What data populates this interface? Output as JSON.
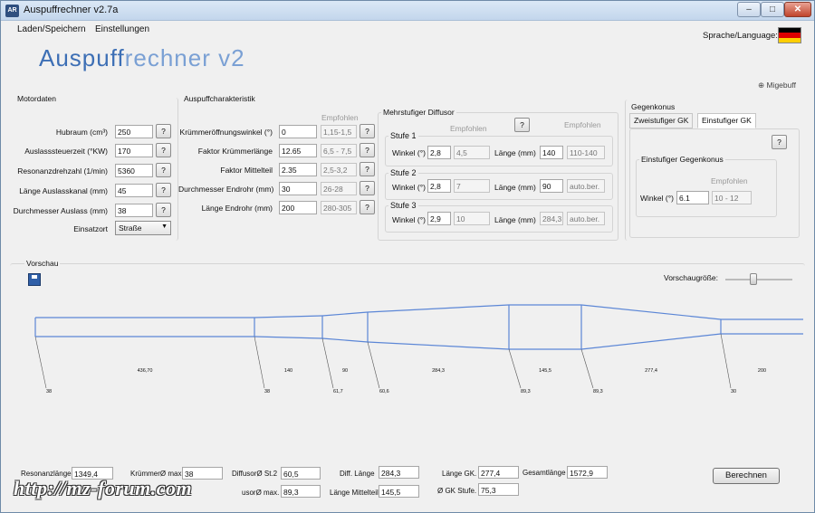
{
  "window": {
    "title": "Auspuffrechner v2.7a",
    "icon": "AR"
  },
  "menu": {
    "items": [
      "Laden/Speichern",
      "Einstellungen"
    ],
    "language_label": "Sprache/Language:",
    "flag_colors": [
      "#000000",
      "#dd0000",
      "#ffce00"
    ]
  },
  "logo": {
    "part1": "Auspuff",
    "part2": "rechner  v2"
  },
  "migebuff": "⊕ Migebuff",
  "motordaten": {
    "title": "Motordaten",
    "rows": [
      {
        "label": "Hubraum (cm³)",
        "value": "250"
      },
      {
        "label": "Auslasssteuerzeit (°KW)",
        "value": "170"
      },
      {
        "label": "Resonanzdrehzahl (1/min)",
        "value": "5360"
      },
      {
        "label": "Länge Auslasskanal (mm)",
        "value": "45"
      },
      {
        "label": "Durchmesser Auslass (mm)",
        "value": "38"
      }
    ],
    "einsatzort_label": "Einsatzort",
    "einsatzort_value": "Straße",
    "help": "?"
  },
  "auspuff": {
    "title": "Auspuffcharakteristik",
    "empfohlen": "Empfohlen",
    "rows": [
      {
        "label": "Krümmeröffnungswinkel (°)",
        "value": "0",
        "rec": "1,15-1,5"
      },
      {
        "label": "Faktor Krümmerlänge",
        "value": "12.65",
        "rec": "6,5 - 7,5"
      },
      {
        "label": "Faktor Mittelteil",
        "value": "2.35",
        "rec": "2,5-3,2"
      },
      {
        "label": "Durchmesser Endrohr (mm)",
        "value": "30",
        "rec": "26-28"
      },
      {
        "label": "Länge Endrohr (mm)",
        "value": "200",
        "rec": "280-305"
      }
    ]
  },
  "diffusor": {
    "title": "Mehrstufiger Diffusor",
    "empfohlen1": "Empfohlen",
    "empfohlen2": "Empfohlen",
    "winkel_label": "Winkel (°)",
    "laenge_label": "Länge (mm)",
    "stufen": [
      {
        "name": "Stufe 1",
        "winkel": "2,8",
        "winkel_rec": "4,5",
        "laenge": "140",
        "laenge_rec": "110-140"
      },
      {
        "name": "Stufe 2",
        "winkel": "2,8",
        "winkel_rec": "7",
        "laenge": "90",
        "laenge_rec": "auto.ber."
      },
      {
        "name": "Stufe 3",
        "winkel": "2,9",
        "winkel_rec": "10",
        "laenge": "284,3",
        "laenge_rec": "auto.ber."
      }
    ]
  },
  "gegenkonus": {
    "title": "Gegenkonus",
    "tabs": [
      "Zweistufiger GK",
      "Einstufiger GK"
    ],
    "inner_title": "Einstufiger Gegenkonus",
    "empfohlen": "Empfohlen",
    "winkel_label": "Winkel (°)",
    "winkel": "6.1",
    "winkel_rec": "10 - 12"
  },
  "vorschau": {
    "title": "Vorschau",
    "size_label": "Vorschaugröße:",
    "line_color": "#5b86d6",
    "lengths": [
      "436,70",
      "140",
      "90",
      "284,3",
      "145,5",
      "277,4",
      "200"
    ],
    "diameters": [
      "38",
      "38",
      "61,7",
      "60,6",
      "89,3",
      "89,3",
      "30"
    ]
  },
  "results": {
    "resonanzlaenge_label": "Resonanzlänge",
    "resonanzlaenge": "1349,4",
    "kruemmer_max_label": "KrümmerØ max",
    "kruemmer_max": "38",
    "diffusor_st2_label": "DiffusorØ St.2",
    "diffusor_st2": "60,5",
    "diff_laenge_label": "Diff. Länge",
    "diff_laenge": "284,3",
    "laenge_gk_label": "Länge GK.",
    "laenge_gk": "277,4",
    "gesamtlaenge_label": "Gesamtlänge",
    "gesamtlaenge": "1572,9",
    "diffusor_max_label": "usorØ max.",
    "diffusor_max": "89,3",
    "laenge_mittelteil_label": "Länge Mittelteil",
    "laenge_mittelteil": "145,5",
    "gk_stufe_label": "Ø GK Stufe.",
    "gk_stufe": "75,3",
    "berechnen": "Berechnen"
  },
  "watermark": "http://mz-forum.com"
}
